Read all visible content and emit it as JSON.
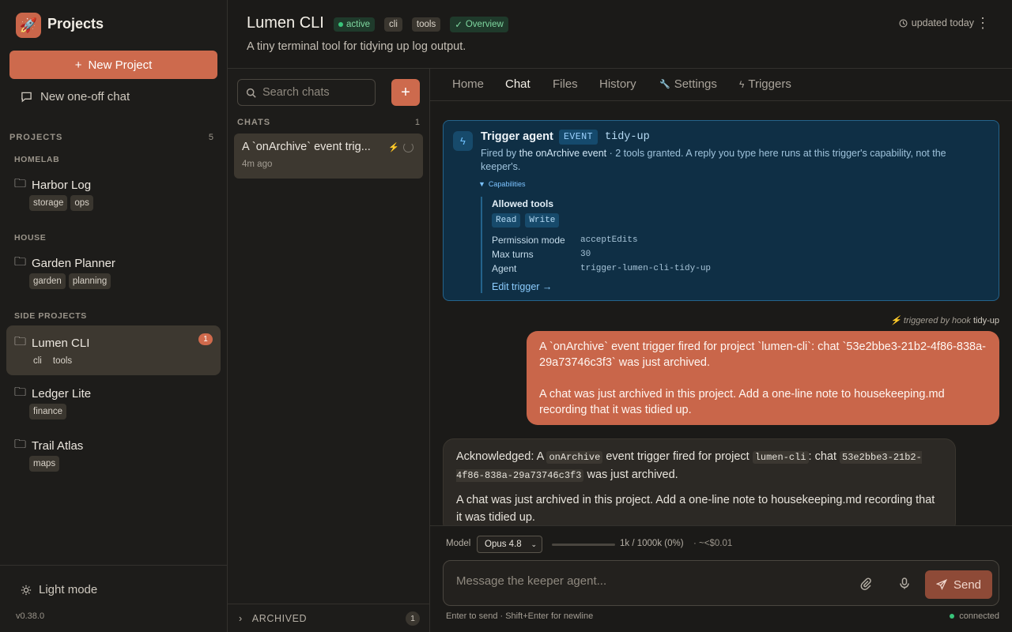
{
  "sidebar": {
    "brand": "Projects",
    "new_project_label": "New Project",
    "new_chat_label": "New one-off chat",
    "projects_header": "PROJECTS",
    "projects_count": "5",
    "groups": [
      "HOMELAB",
      "HOUSE",
      "SIDE PROJECTS"
    ],
    "projects": [
      {
        "name": "Harbor Log",
        "tags": [
          "storage",
          "ops"
        ]
      },
      {
        "name": "Garden Planner",
        "tags": [
          "garden",
          "planning"
        ]
      },
      {
        "name": "Lumen CLI",
        "tags": [
          "cli",
          "tools"
        ],
        "badge": "1"
      },
      {
        "name": "Ledger Lite",
        "tags": [
          "finance"
        ]
      },
      {
        "name": "Trail Atlas",
        "tags": [
          "maps"
        ]
      }
    ],
    "light_mode_label": "Light mode",
    "version": "v0.38.0"
  },
  "header": {
    "title": "Lumen CLI",
    "status": "active",
    "tags": [
      "cli",
      "tools"
    ],
    "overview_label": "Overview",
    "subtitle": "A tiny terminal tool for tidying up log output.",
    "updated": "updated today"
  },
  "chat_list": {
    "search_placeholder": "Search chats",
    "header": "CHATS",
    "count": "1",
    "items": [
      {
        "title": "A `onArchive` event trig...",
        "time": "4m ago"
      }
    ],
    "archived_label": "ARCHIVED",
    "archived_count": "1"
  },
  "tabs": [
    "Home",
    "Chat",
    "Files",
    "History",
    "Settings",
    "Triggers"
  ],
  "trigger_card": {
    "title": "Trigger agent",
    "event_badge": "EVENT",
    "name": "tidy-up",
    "desc_pre": "Fired by ",
    "desc_event": "the onArchive event",
    "desc_post": " · 2 tools granted. A reply you type here runs at this trigger's capability, not the keeper's.",
    "capabilities_label": "Capabilities",
    "allowed_tools_label": "Allowed tools",
    "tools": [
      "Read",
      "Write"
    ],
    "permission_mode_label": "Permission mode",
    "permission_mode": "acceptEdits",
    "max_turns_label": "Max turns",
    "max_turns": "30",
    "agent_label": "Agent",
    "agent": "trigger-lumen-cli-tidy-up",
    "edit_label": "Edit trigger →"
  },
  "triggered_by": {
    "prefix": "⚡ triggered by hook",
    "name": "tidy-up"
  },
  "user_message": {
    "p1": "A `onArchive` event trigger fired for project `lumen-cli`: chat `53e2bbe3-21b2-4f86-838a-29a73746c3f3` was just archived.",
    "p2": "A chat was just archived in this project. Add a one-line note to housekeeping.md recording that it was tidied up."
  },
  "assistant_message": {
    "a1": "Acknowledged: A ",
    "c1": "onArchive",
    "a2": " event trigger fired for project ",
    "c2": "lumen-cli",
    "a3": ": chat ",
    "c3": "53e2bbe3-21b2-4f86-838a-29a73746c3f3",
    "a4": " was just archived.",
    "p2": "A chat was just archived in this project. Add a one-line note to housekeeping.md recording that it was tidied up."
  },
  "composer": {
    "model_label": "Model",
    "model": "Opus 4.8",
    "context": "1k / 1000k (0%)",
    "context_fraction": 0.0,
    "cost": "· ~<$0.01",
    "placeholder": "Message the keeper agent...",
    "send_label": "Send",
    "hint": "Enter to send · Shift+Enter for newline",
    "status": "connected"
  },
  "colors": {
    "accent": "#cd6a4d",
    "trigger_bg": "#0f2f45",
    "trigger_border": "#24638b",
    "online": "#39c47a"
  }
}
